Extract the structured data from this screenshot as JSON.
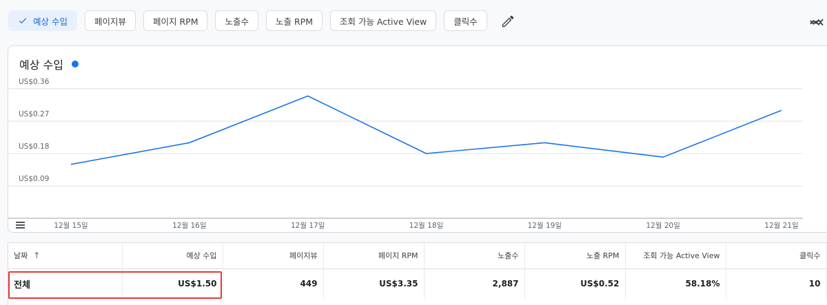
{
  "metric_chips": [
    {
      "label": "예상 수입",
      "selected": true
    },
    {
      "label": "페이지뷰",
      "selected": false
    },
    {
      "label": "페이지 RPM",
      "selected": false
    },
    {
      "label": "노출수",
      "selected": false
    },
    {
      "label": "노출 RPM",
      "selected": false
    },
    {
      "label": "조회 가능 Active View",
      "selected": false
    },
    {
      "label": "클릭수",
      "selected": false
    }
  ],
  "icons": {
    "check": "check-icon",
    "edit": "pencil-icon",
    "trend": "trend-icon",
    "menu": "menu-icon",
    "sort": "arrow-up-icon"
  },
  "colors": {
    "accent": "#1a73e8",
    "chip_active_bg": "#e8f0fe",
    "highlight": "#e53935"
  },
  "chart_data": {
    "type": "line",
    "title": "예상 수입",
    "categories": [
      "12월 15일",
      "12월 16일",
      "12월 17일",
      "12월 18일",
      "12월 19일",
      "12월 20일",
      "12월 21일"
    ],
    "series": [
      {
        "values": [
          0.15,
          0.21,
          0.34,
          0.18,
          0.21,
          0.17,
          0.3
        ]
      }
    ],
    "y_ticks": [
      "US$0.36",
      "US$0.27",
      "US$0.18",
      "US$0.09"
    ],
    "y_tick_values": [
      0.36,
      0.27,
      0.18,
      0.09
    ],
    "ylim": [
      0.0,
      0.36
    ],
    "grid": true,
    "color": "#1a73e8"
  },
  "table": {
    "headers": [
      "날짜",
      "예상 수입",
      "페이지뷰",
      "페이지 RPM",
      "노출수",
      "노출 RPM",
      "조회 가능 Active View",
      "클릭수"
    ],
    "sort_indicator": "↑",
    "rows": [
      [
        "전체",
        "US$1.50",
        "449",
        "US$3.35",
        "2,887",
        "US$0.52",
        "58.18%",
        "10"
      ]
    ]
  }
}
